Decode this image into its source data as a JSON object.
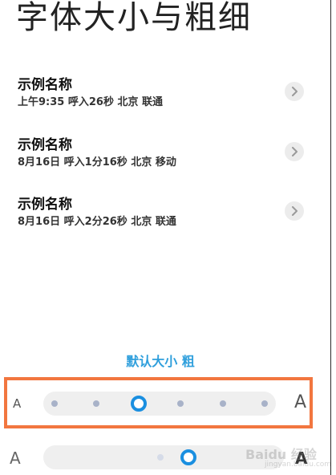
{
  "header": {
    "title": "字体大小与粗细"
  },
  "calls": [
    {
      "name": "示例名称",
      "meta": "上午9:35  呼入26秒  北京  联通"
    },
    {
      "name": "示例名称",
      "meta": "8月16日  呼入1分16秒  北京  移动"
    },
    {
      "name": "示例名称",
      "meta": "8月16日  呼入2分26秒  北京  联通"
    }
  ],
  "font_setting": {
    "label": "默认大小  粗",
    "small_glyph": "A",
    "large_glyph": "A"
  },
  "size_slider": {
    "steps": 6,
    "selected_index": 2
  },
  "weight_slider": {
    "small_glyph": "A",
    "large_glyph": "A",
    "selected_index": 1
  },
  "watermark": {
    "text": "Baidu 经验",
    "sub": "jingyan.baidu.com"
  },
  "colors": {
    "accent": "#1a8fe0",
    "label_blue": "#2f9fdc",
    "highlight": "#f2763f"
  }
}
